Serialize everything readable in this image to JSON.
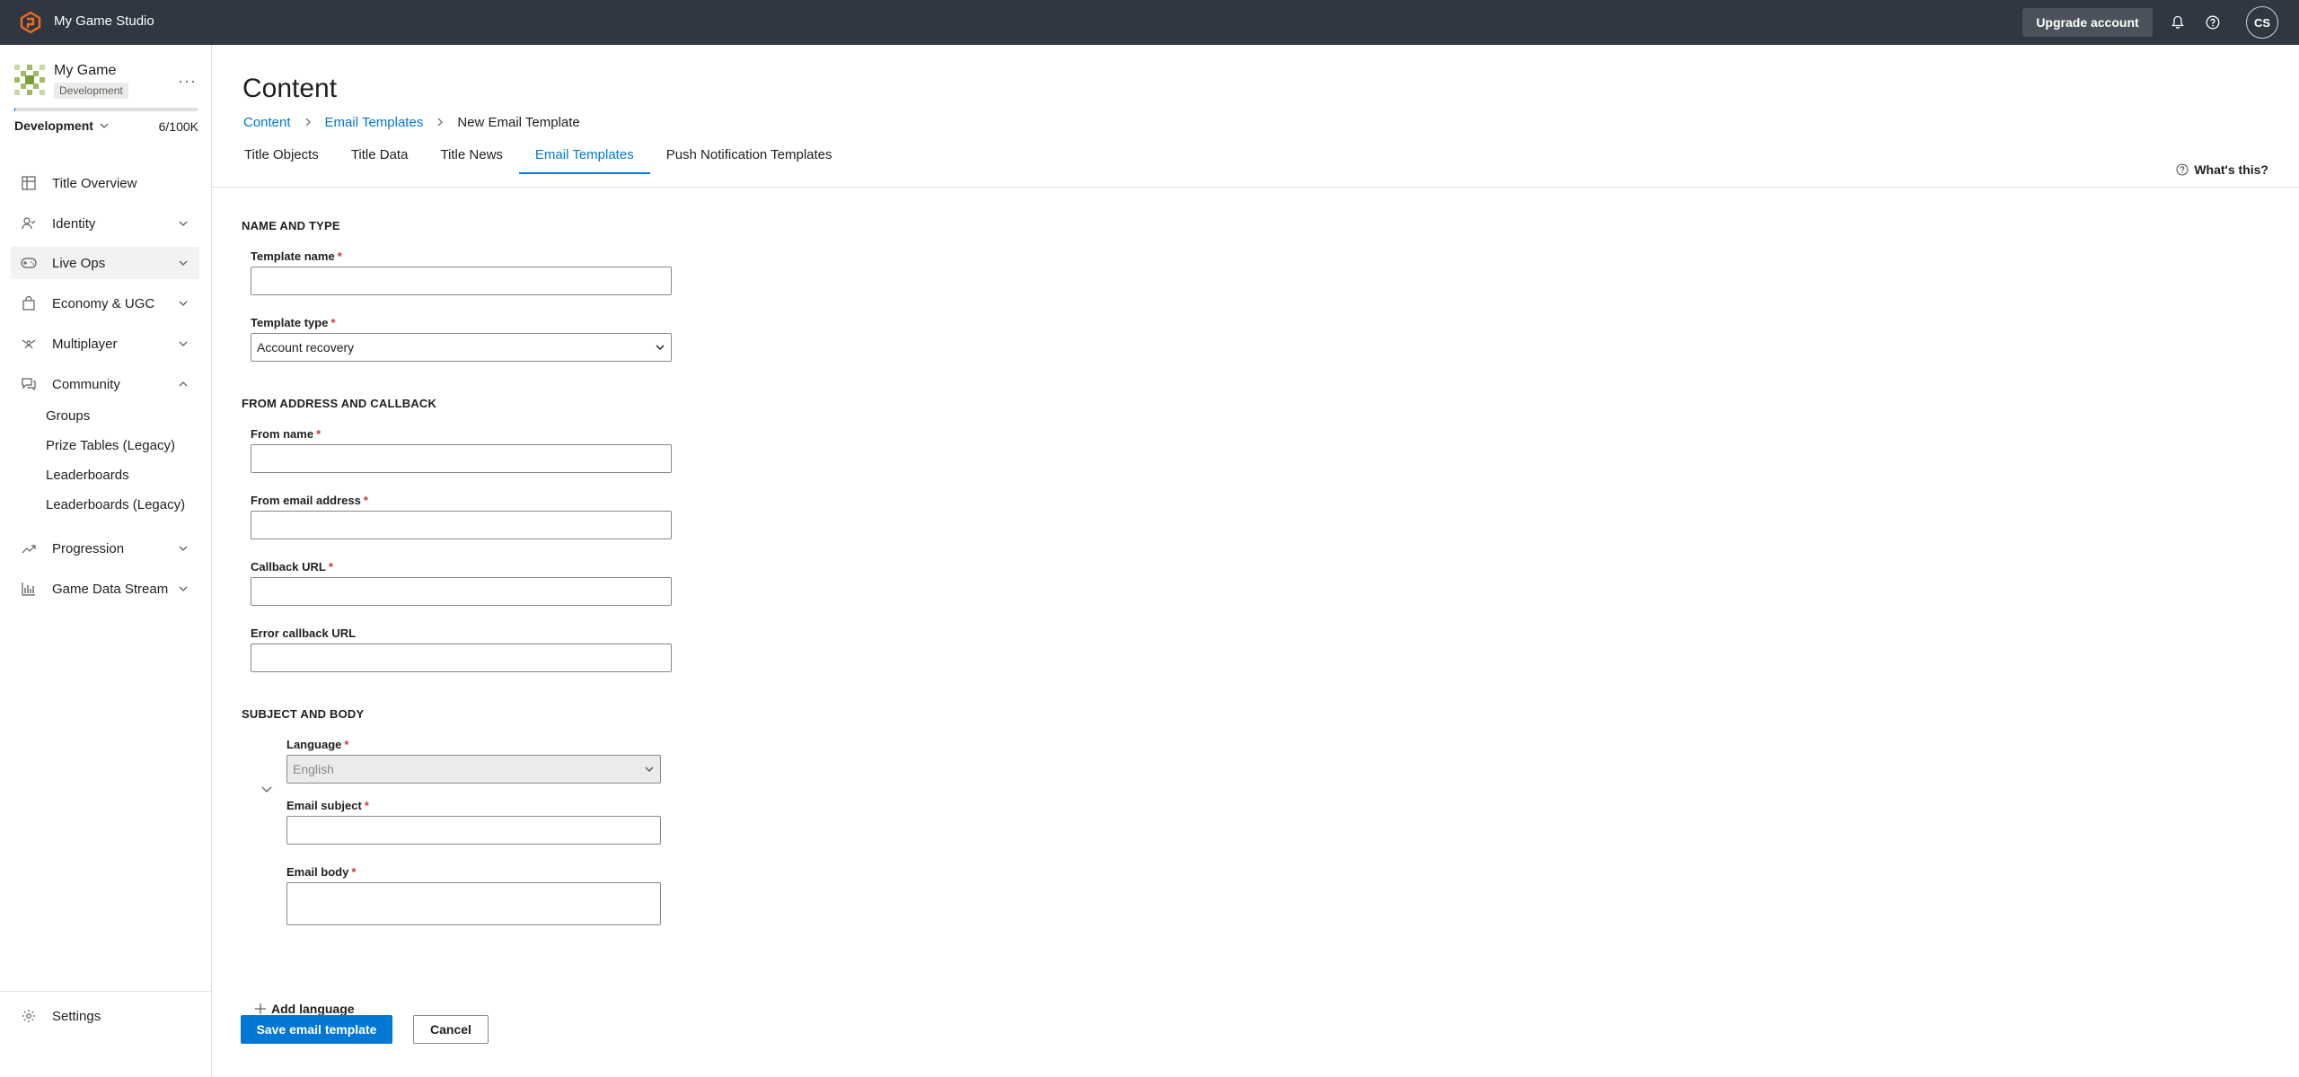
{
  "topbar": {
    "studio_name": "My Game Studio",
    "upgrade_label": "Upgrade account",
    "avatar_initials": "CS"
  },
  "sidebar": {
    "game_name": "My Game",
    "environment_badge": "Development",
    "environment_select": "Development",
    "usage": "6/100K",
    "usage_fraction": 6e-05,
    "nav": [
      {
        "label": "Title Overview",
        "icon": "grid-icon"
      },
      {
        "label": "Identity",
        "icon": "identity-icon"
      },
      {
        "label": "Live Ops",
        "icon": "gamepad-icon"
      },
      {
        "label": "Economy & UGC",
        "icon": "bag-icon"
      },
      {
        "label": "Multiplayer",
        "icon": "multiplayer-icon"
      },
      {
        "label": "Community",
        "icon": "chat-icon"
      },
      {
        "label": "Progression",
        "icon": "trend-icon"
      },
      {
        "label": "Game Data Stream",
        "icon": "bar-chart-icon"
      }
    ],
    "community_sub": [
      "Groups",
      "Prize Tables (Legacy)",
      "Leaderboards",
      "Leaderboards (Legacy)"
    ],
    "settings_label": "Settings"
  },
  "main": {
    "title": "Content",
    "breadcrumb": [
      "Content",
      "Email Templates",
      "New Email Template"
    ],
    "tabs": [
      "Title Objects",
      "Title Data",
      "Title News",
      "Email Templates",
      "Push Notification Templates"
    ],
    "whats_this": "What's this?"
  },
  "form": {
    "section_name_type": "NAME AND TYPE",
    "template_name_label": "Template name",
    "template_name_value": "",
    "template_type_label": "Template type",
    "template_type_value": "Account recovery",
    "section_from": "FROM ADDRESS AND CALLBACK",
    "from_name_label": "From name",
    "from_email_label": "From email address",
    "callback_url_label": "Callback URL",
    "error_callback_label": "Error callback URL",
    "section_subject": "SUBJECT AND BODY",
    "language_label": "Language",
    "language_value": "English",
    "email_subject_label": "Email subject",
    "email_body_label": "Email body",
    "add_language_label": "Add language",
    "required_mark": "*"
  },
  "actions": {
    "save_label": "Save email template",
    "cancel_label": "Cancel"
  },
  "colors": {
    "topbar": "#2f3740",
    "accent": "#0078d4",
    "required": "#d13438"
  }
}
